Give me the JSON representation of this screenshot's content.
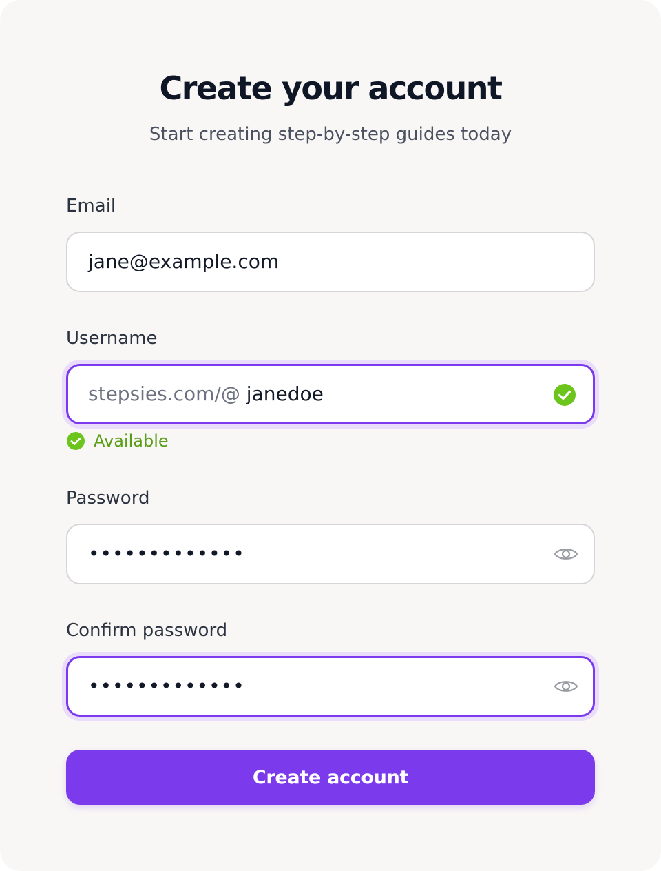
{
  "header": {
    "title": "Create your account",
    "subtitle": "Start creating step-by-step guides today"
  },
  "form": {
    "email": {
      "label": "Email",
      "value": "jane@example.com"
    },
    "username": {
      "label": "Username",
      "prefix": "stepsies.com/@",
      "value": "janedoe",
      "status_icon": "check-circle-icon",
      "status_text": "Available"
    },
    "password": {
      "label": "Password",
      "value": "•••••••••••••",
      "toggle_icon": "eye-icon"
    },
    "confirm_password": {
      "label": "Confirm password",
      "value": "•••••••••••••",
      "toggle_icon": "eye-icon"
    },
    "submit_label": "Create account"
  },
  "colors": {
    "accent": "#7c3aed",
    "success": "#6cc51d",
    "success_text": "#5a9d16",
    "card_background": "#f8f7f5"
  }
}
